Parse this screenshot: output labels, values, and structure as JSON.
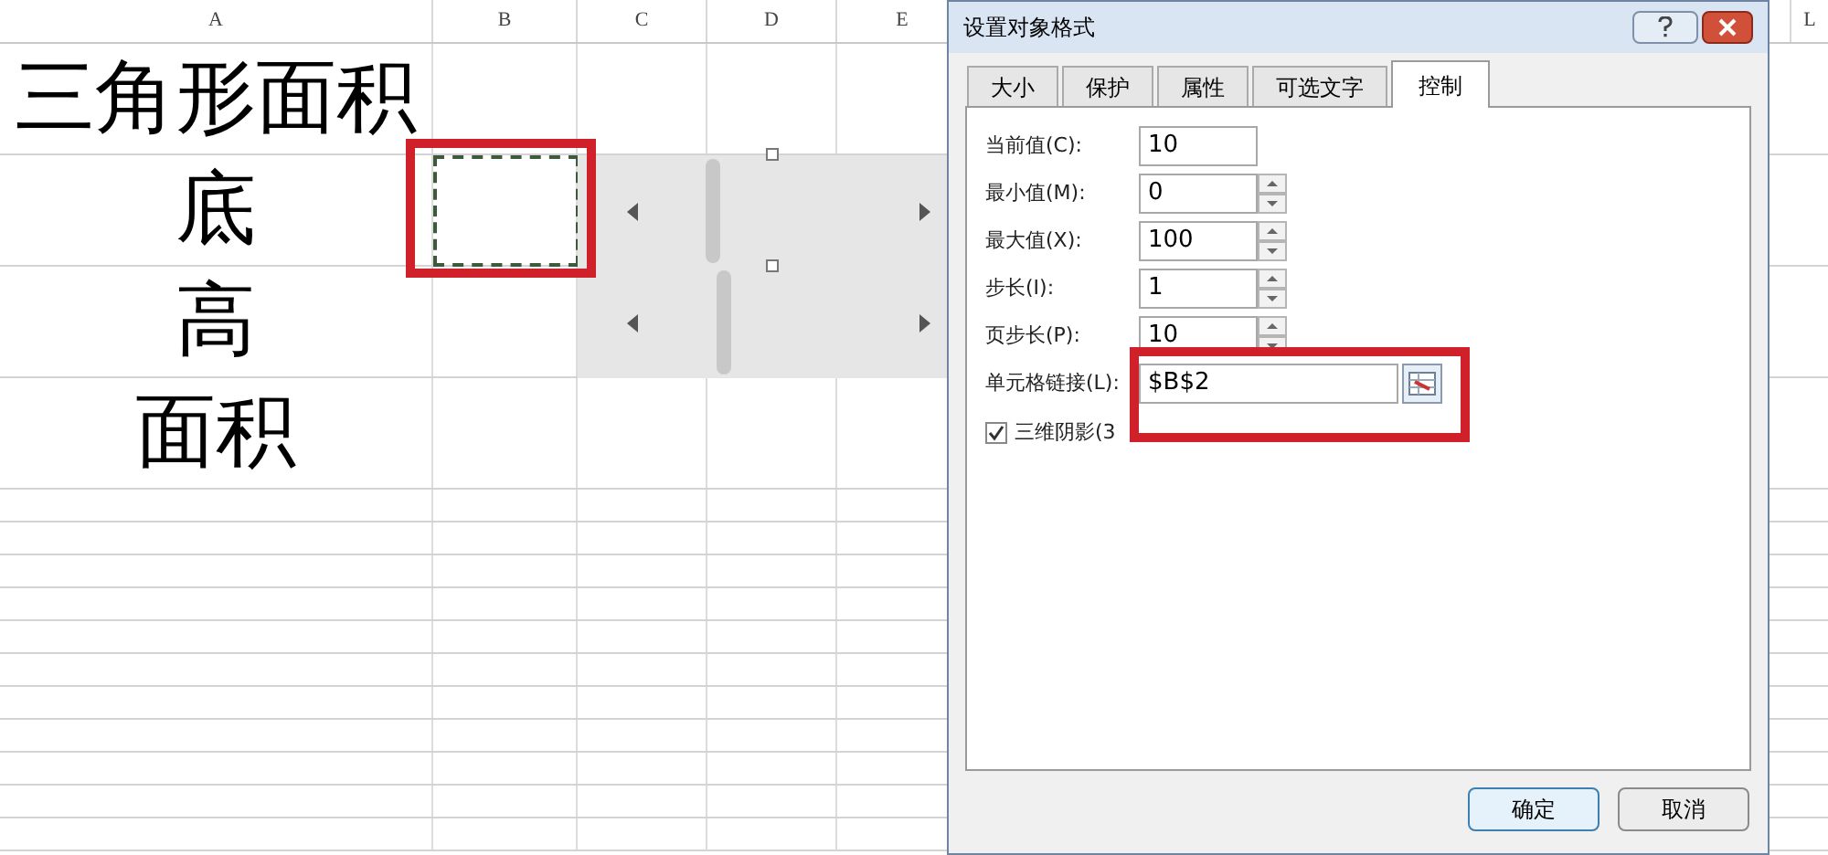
{
  "sheet": {
    "columns": [
      "A",
      "B",
      "C",
      "D",
      "E",
      "L"
    ],
    "rows": [
      {
        "cells": [
          "三角形面积"
        ]
      },
      {
        "cells": [
          "底"
        ]
      },
      {
        "cells": [
          "高"
        ]
      },
      {
        "cells": [
          "面积"
        ]
      }
    ]
  },
  "dialog": {
    "title": "设置对象格式",
    "tabs": [
      {
        "label": "大小",
        "selected": false
      },
      {
        "label": "保护",
        "selected": false
      },
      {
        "label": "属性",
        "selected": false
      },
      {
        "label": "可选文字",
        "selected": false
      },
      {
        "label": "控制",
        "selected": true
      }
    ],
    "fields": [
      {
        "kind": "text",
        "label": "当前值(C):",
        "value": "10"
      },
      {
        "kind": "spin",
        "label": "最小值(M):",
        "value": "0"
      },
      {
        "kind": "spin",
        "label": "最大值(X):",
        "value": "100"
      },
      {
        "kind": "spin",
        "label": "步长(I):",
        "value": "1"
      },
      {
        "kind": "spin",
        "label": "页步长(P):",
        "value": "10"
      },
      {
        "kind": "ref",
        "label": "单元格链接(L):",
        "value": "$B$2"
      }
    ],
    "shading": {
      "label": "三维阴影(3",
      "checked": true
    },
    "buttons": [
      "确定",
      "取消"
    ]
  }
}
